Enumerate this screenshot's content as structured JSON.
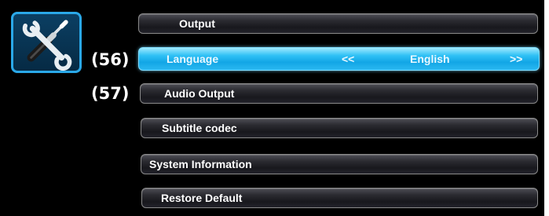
{
  "icon": {
    "name": "wrench-screwdriver-icon"
  },
  "markers": {
    "language": "(56)",
    "audio": "(57)"
  },
  "menu": {
    "items": [
      {
        "label": "Output"
      },
      {
        "label": "Language",
        "left_arrow": "<<",
        "value": "English",
        "right_arrow": ">>"
      },
      {
        "label": "Audio Output"
      },
      {
        "label": "Subtitle codec"
      },
      {
        "label": "System Information"
      },
      {
        "label": "Restore Default"
      }
    ]
  },
  "colors": {
    "background": "#000000",
    "selected_highlight": "#1ab0ee",
    "icon_border": "#2aa8e8"
  }
}
